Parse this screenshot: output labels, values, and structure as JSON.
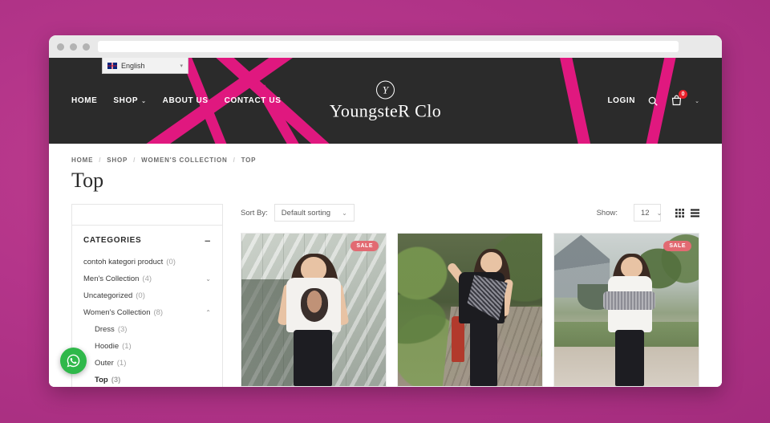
{
  "browser": {
    "url_value": "",
    "url_placeholder": ""
  },
  "language_selector": {
    "label": "English",
    "caret": "▾",
    "flag": "uk-flag-icon"
  },
  "header": {
    "nav": [
      {
        "label": "HOME",
        "has_dropdown": false
      },
      {
        "label": "SHOP",
        "has_dropdown": true,
        "caret": "⌄"
      },
      {
        "label": "ABOUT US",
        "has_dropdown": false
      },
      {
        "label": "CONTACT US",
        "has_dropdown": false
      }
    ],
    "brand": {
      "monogram": "Y",
      "name": "YoungsteR Clo"
    },
    "login_label": "LOGIN",
    "search_icon": "search-icon",
    "cart_icon": "shopping-bag-icon",
    "cart_count": "0",
    "cart_caret": "⌄",
    "background_color": "#2b2b2b",
    "stripe_color": "#e0187f"
  },
  "breadcrumb": {
    "items": [
      "HOME",
      "SHOP",
      "WOMEN'S COLLECTION",
      "TOP"
    ],
    "separator": "/"
  },
  "page": {
    "title": "Top"
  },
  "toolbar": {
    "sort_label": "Sort By:",
    "sort_value": "Default sorting",
    "sort_caret": "⌄",
    "show_label": "Show:",
    "show_value": "12",
    "show_caret": "⌄",
    "grid_view_icon": "grid-view-icon",
    "list_view_icon": "list-view-icon"
  },
  "sidebar": {
    "widget_title": "CATEGORIES",
    "collapse_sign": "–",
    "categories": [
      {
        "label": "contoh kategori product",
        "count": "(0)",
        "expander": "",
        "active": false,
        "sub": false
      },
      {
        "label": "Men's Collection",
        "count": "(4)",
        "expander": "⌄",
        "active": false,
        "sub": false
      },
      {
        "label": "Uncategorized",
        "count": "(0)",
        "expander": "",
        "active": false,
        "sub": false
      },
      {
        "label": "Women's Collection",
        "count": "(8)",
        "expander": "⌃",
        "active": false,
        "sub": false
      },
      {
        "label": "Dress",
        "count": "(3)",
        "expander": "",
        "active": false,
        "sub": true
      },
      {
        "label": "Hoodie",
        "count": "(1)",
        "expander": "",
        "active": false,
        "sub": true
      },
      {
        "label": "Outer",
        "count": "(1)",
        "expander": "",
        "active": false,
        "sub": true
      },
      {
        "label": "Top",
        "count": "(3)",
        "expander": "",
        "active": true,
        "sub": true
      }
    ]
  },
  "products": [
    {
      "sale_badge": "SALE",
      "has_sale": true,
      "scene": "glass-building",
      "alt": "woman in white graphic tee and black jeans"
    },
    {
      "sale_badge": "",
      "has_sale": false,
      "scene": "garden-path",
      "alt": "woman in grey wrap top and black jeans"
    },
    {
      "sale_badge": "SALE",
      "has_sale": true,
      "scene": "park-fountain",
      "alt": "woman in white top with grey sleeves"
    }
  ],
  "floating": {
    "whatsapp_label": "whatsapp-icon"
  },
  "colors": {
    "page_background": "#b4358a",
    "header_dark": "#2b2b2b",
    "accent_pink": "#e0187f",
    "sale_badge": "#e26a72",
    "cart_badge": "#e8202a",
    "whatsapp_green": "#2fb84a"
  }
}
